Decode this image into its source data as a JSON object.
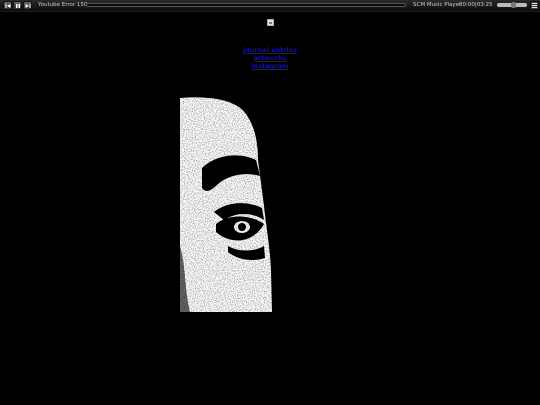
{
  "player": {
    "track_title": "Youtube Error 150",
    "progress": 0,
    "player_name": "SCM Music Player",
    "time": "00:00|03:25",
    "volume": 0.55,
    "icons": [
      "prev-icon",
      "pause-icon",
      "next-icon",
      "menu-icon"
    ]
  },
  "header": {
    "links": [
      "journal entries",
      "artworks",
      "instagram"
    ],
    "link_color": "#0a0adc"
  }
}
